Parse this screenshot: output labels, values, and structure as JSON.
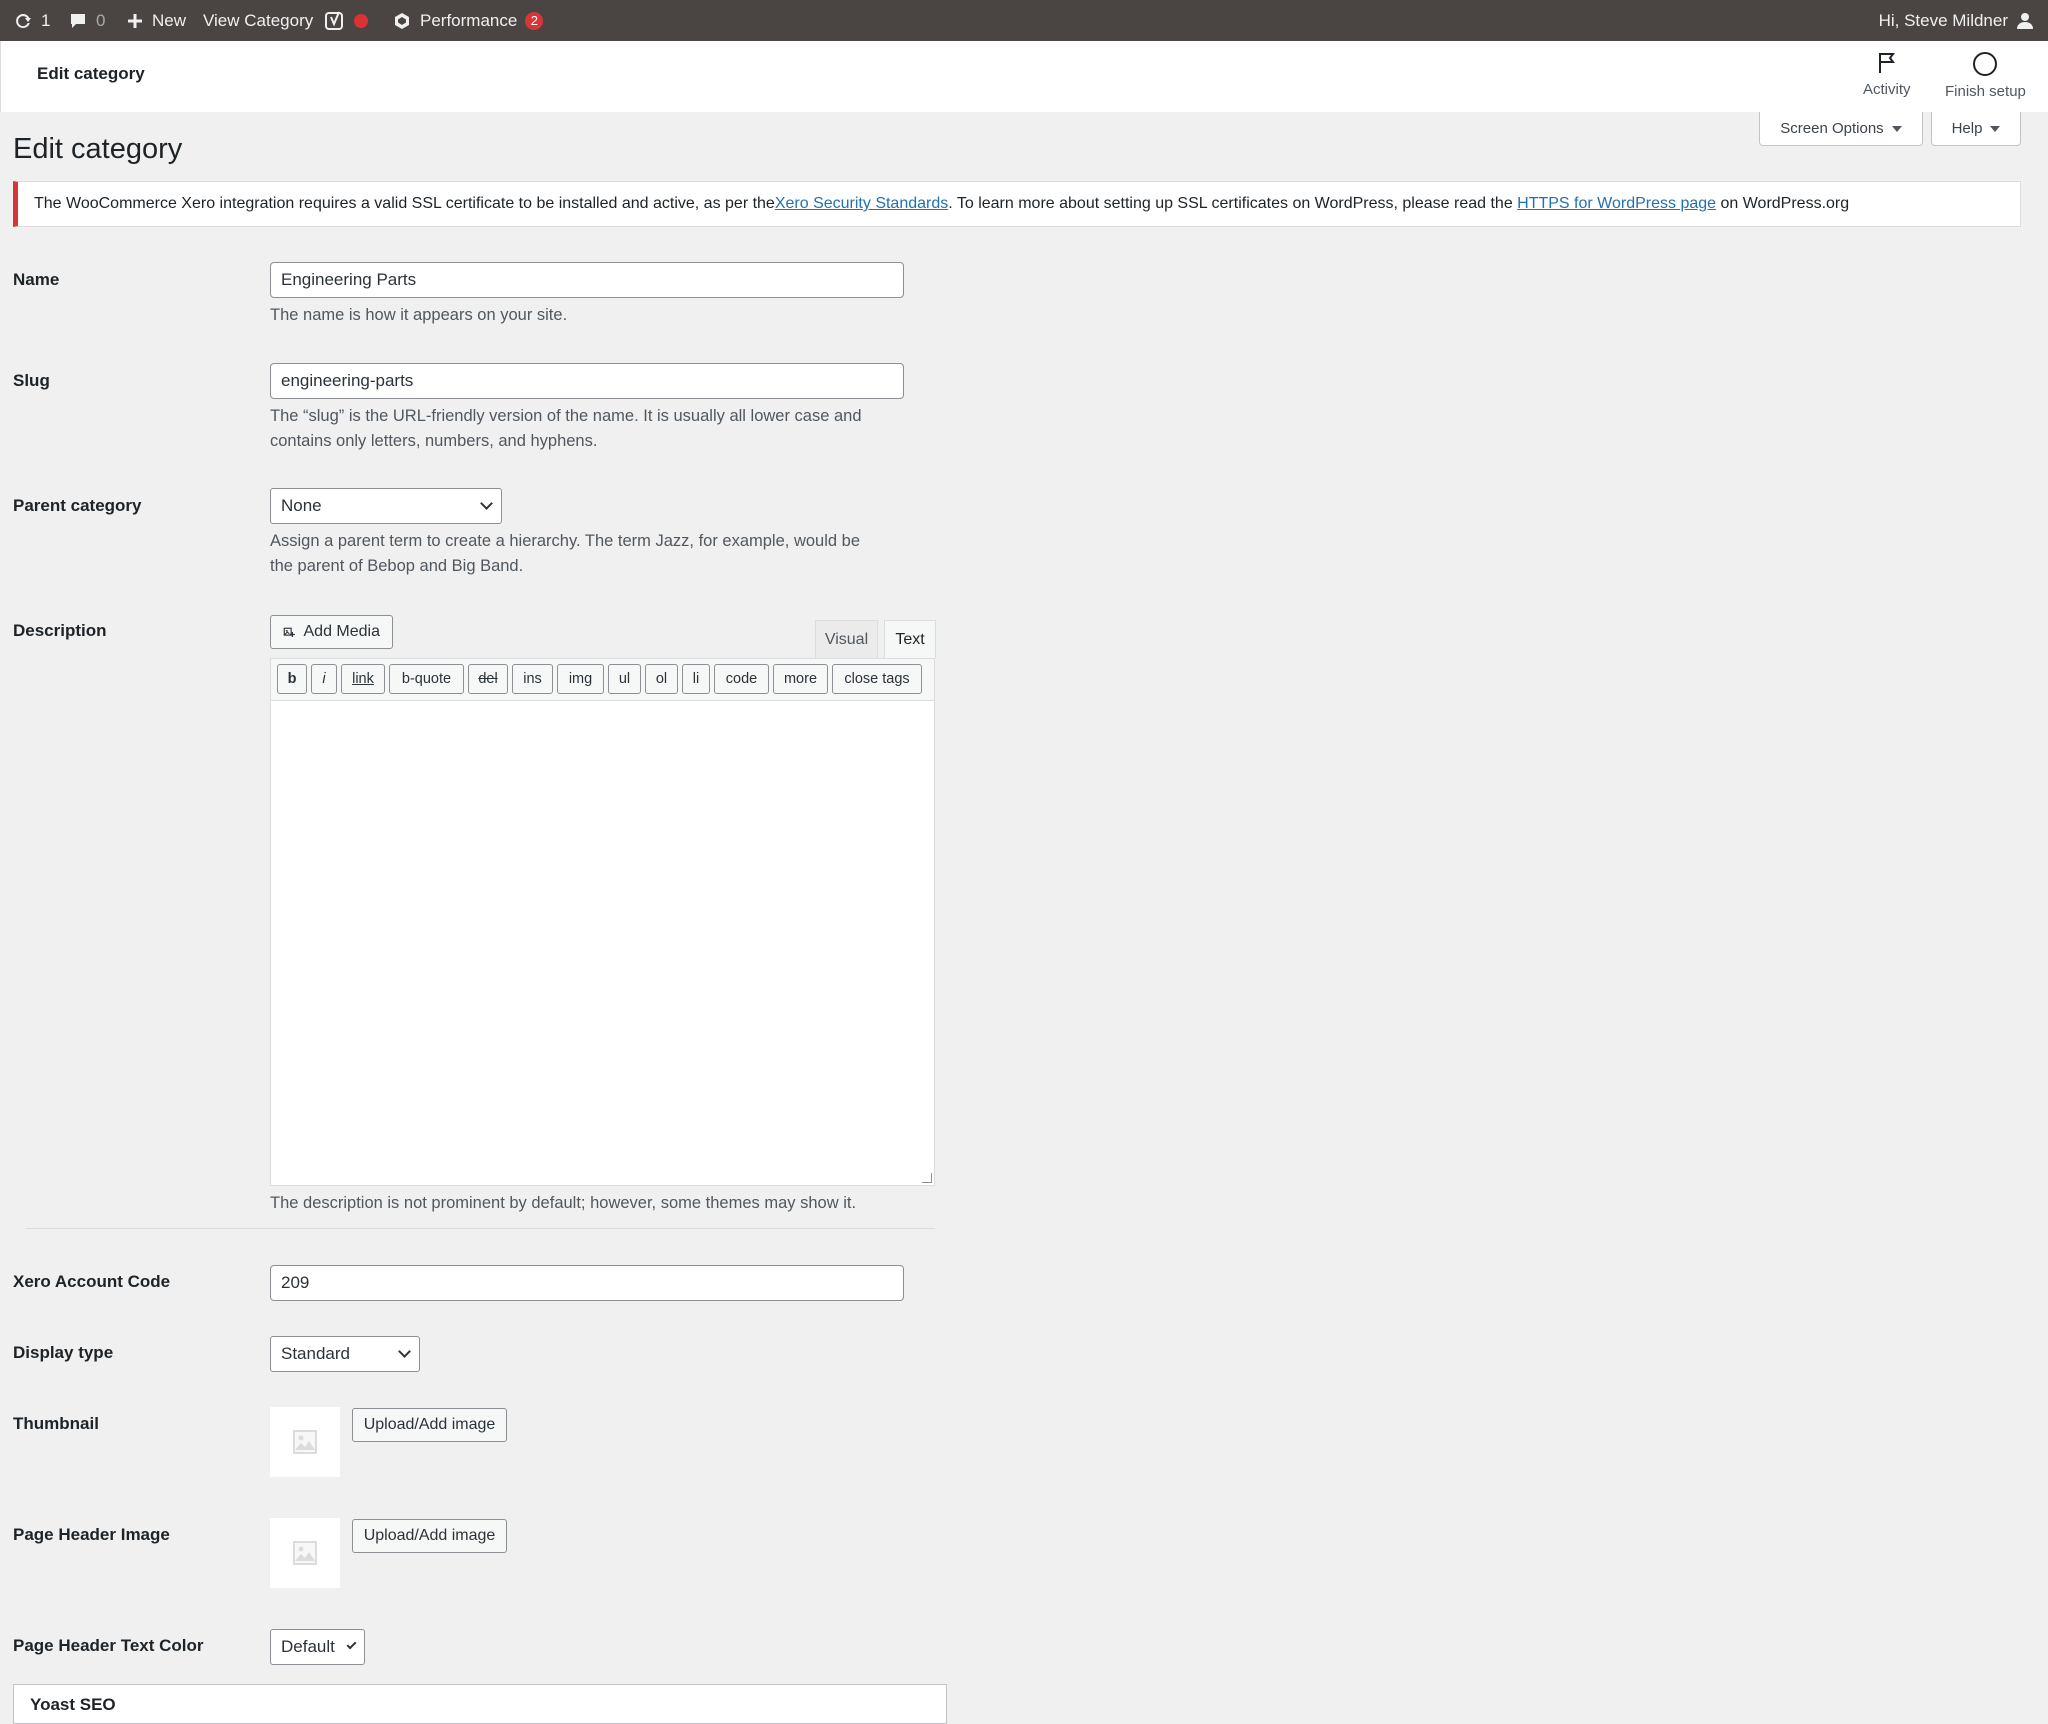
{
  "adminbar": {
    "updates_count": "1",
    "comments_count": "0",
    "new_label": "New",
    "view_category_label": "View Category",
    "performance_label": "Performance",
    "performance_badge": "2",
    "greeting": "Hi, Steve Mildner"
  },
  "wc_header": {
    "title": "Edit category",
    "activity_label": "Activity",
    "finish_setup_label": "Finish setup"
  },
  "screen_options_label": "Screen Options",
  "help_label": "Help",
  "page_title": "Edit category",
  "notice": {
    "text_1": "The WooCommerce Xero integration requires a valid SSL certificate to be installed and active, as per the ",
    "link_1": "Xero Security Standards",
    "text_2": ". To learn more about setting up SSL certificates on WordPress, please read the ",
    "link_2": "HTTPS for WordPress page",
    "text_3": " on WordPress.org"
  },
  "form": {
    "name_label": "Name",
    "name_value": "Engineering Parts",
    "name_desc": "The name is how it appears on your site.",
    "slug_label": "Slug",
    "slug_value": "engineering-parts",
    "slug_desc_1": "The “slug” is the URL-friendly version of the name. It is usually all lower case and",
    "slug_desc_2": "contains only letters, numbers, and hyphens.",
    "parent_label": "Parent category",
    "parent_value": "None",
    "parent_desc_1": "Assign a parent term to create a hierarchy. The term Jazz, for example, would be",
    "parent_desc_2": "the parent of Bebop and Big Band.",
    "description_label": "Description",
    "add_media_label": "Add Media",
    "tab_visual": "Visual",
    "tab_text": "Text",
    "quicktags": [
      "b",
      "i",
      "link",
      "b-quote",
      "del",
      "ins",
      "img",
      "ul",
      "ol",
      "li",
      "code",
      "more",
      "close tags"
    ],
    "description_desc": "The description is not prominent by default; however, some themes may show it.",
    "xero_label": "Xero Account Code",
    "xero_value": "209",
    "display_type_label": "Display type",
    "display_type_value": "Standard",
    "thumbnail_label": "Thumbnail",
    "upload_label": "Upload/Add image",
    "page_header_image_label": "Page Header Image",
    "page_header_text_color_label": "Page Header Text Color",
    "page_header_text_color_value": "Default",
    "yoast_title": "Yoast SEO"
  }
}
